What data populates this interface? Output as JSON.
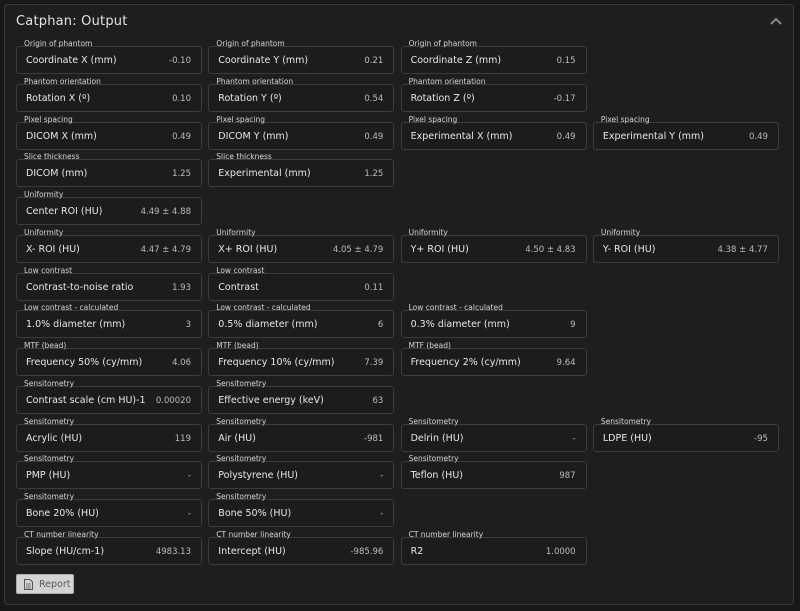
{
  "panel": {
    "title": "Catphan: Output",
    "report_label": "Report"
  },
  "rows": [
    {
      "cells": [
        {
          "caption": "Origin of phantom",
          "label": "Coordinate X (mm)",
          "value": "-0.10"
        },
        {
          "caption": "Origin of phantom",
          "label": "Coordinate Y (mm)",
          "value": "0.21"
        },
        {
          "caption": "Origin of phantom",
          "label": "Coordinate Z (mm)",
          "value": "0.15"
        }
      ]
    },
    {
      "cells": [
        {
          "caption": "Phantom orientation",
          "label": "Rotation X (º)",
          "value": "0.10"
        },
        {
          "caption": "Phantom orientation",
          "label": "Rotation Y (º)",
          "value": "0.54"
        },
        {
          "caption": "Phantom orientation",
          "label": "Rotation Z (º)",
          "value": "-0.17"
        }
      ]
    },
    {
      "cells": [
        {
          "caption": "Pixel spacing",
          "label": "DICOM X (mm)",
          "value": "0.49"
        },
        {
          "caption": "Pixel spacing",
          "label": "DICOM Y (mm)",
          "value": "0.49"
        },
        {
          "caption": "Pixel spacing",
          "label": "Experimental X (mm)",
          "value": "0.49"
        },
        {
          "caption": "Pixel spacing",
          "label": "Experimental Y (mm)",
          "value": "0.49"
        }
      ]
    },
    {
      "cells": [
        {
          "caption": "Slice thickness",
          "label": "DICOM (mm)",
          "value": "1.25"
        },
        {
          "caption": "Slice thickness",
          "label": "Experimental (mm)",
          "value": "1.25"
        }
      ]
    },
    {
      "cells": [
        {
          "caption": "Uniformity",
          "label": "Center ROI (HU)",
          "value": "4.49 ± 4.88"
        }
      ]
    },
    {
      "cells": [
        {
          "caption": "Uniformity",
          "label": "X- ROI (HU)",
          "value": "4.47 ± 4.79"
        },
        {
          "caption": "Uniformity",
          "label": "X+ ROI (HU)",
          "value": "4.05 ± 4.79"
        },
        {
          "caption": "Uniformity",
          "label": "Y+ ROI (HU)",
          "value": "4.50 ± 4.83"
        },
        {
          "caption": "Uniformity",
          "label": "Y- ROI (HU)",
          "value": "4.38 ± 4.77"
        }
      ]
    },
    {
      "cells": [
        {
          "caption": "Low contrast",
          "label": "Contrast-to-noise ratio",
          "value": "1.93"
        },
        {
          "caption": "Low contrast",
          "label": "Contrast",
          "value": "0.11"
        }
      ]
    },
    {
      "cells": [
        {
          "caption": "Low contrast - calculated",
          "label": "1.0% diameter (mm)",
          "value": "3"
        },
        {
          "caption": "Low contrast - calculated",
          "label": "0.5% diameter (mm)",
          "value": "6"
        },
        {
          "caption": "Low contrast - calculated",
          "label": "0.3% diameter (mm)",
          "value": "9"
        }
      ]
    },
    {
      "cells": [
        {
          "caption": "MTF (bead)",
          "label": "Frequency 50% (cy/mm)",
          "value": "4.06"
        },
        {
          "caption": "MTF (bead)",
          "label": "Frequency 10% (cy/mm)",
          "value": "7.39"
        },
        {
          "caption": "MTF (bead)",
          "label": "Frequency 2% (cy/mm)",
          "value": "9.64"
        }
      ]
    },
    {
      "cells": [
        {
          "caption": "Sensitometry",
          "label": "Contrast scale (cm HU)-1",
          "value": "0.00020"
        },
        {
          "caption": "Sensitometry",
          "label": "Effective energy (keV)",
          "value": "63"
        }
      ]
    },
    {
      "cells": [
        {
          "caption": "Sensitometry",
          "label": "Acrylic (HU)",
          "value": "119"
        },
        {
          "caption": "Sensitometry",
          "label": "Air (HU)",
          "value": "-981"
        },
        {
          "caption": "Sensitometry",
          "label": "Delrin (HU)",
          "value": "-"
        },
        {
          "caption": "Sensitometry",
          "label": "LDPE (HU)",
          "value": "-95"
        }
      ]
    },
    {
      "cells": [
        {
          "caption": "Sensitometry",
          "label": "PMP (HU)",
          "value": "-"
        },
        {
          "caption": "Sensitometry",
          "label": "Polystyrene (HU)",
          "value": "-"
        },
        {
          "caption": "Sensitometry",
          "label": "Teflon (HU)",
          "value": "987"
        }
      ]
    },
    {
      "cells": [
        {
          "caption": "Sensitometry",
          "label": "Bone 20% (HU)",
          "value": "-"
        },
        {
          "caption": "Sensitometry",
          "label": "Bone 50% (HU)",
          "value": "-"
        }
      ]
    },
    {
      "cells": [
        {
          "caption": "CT number linearity",
          "label": "Slope (HU/cm-1)",
          "value": "4983.13"
        },
        {
          "caption": "CT number linearity",
          "label": "Intercept (HU)",
          "value": "-985.96"
        },
        {
          "caption": "CT number linearity",
          "label": "R2",
          "value": "1.0000"
        }
      ]
    }
  ]
}
